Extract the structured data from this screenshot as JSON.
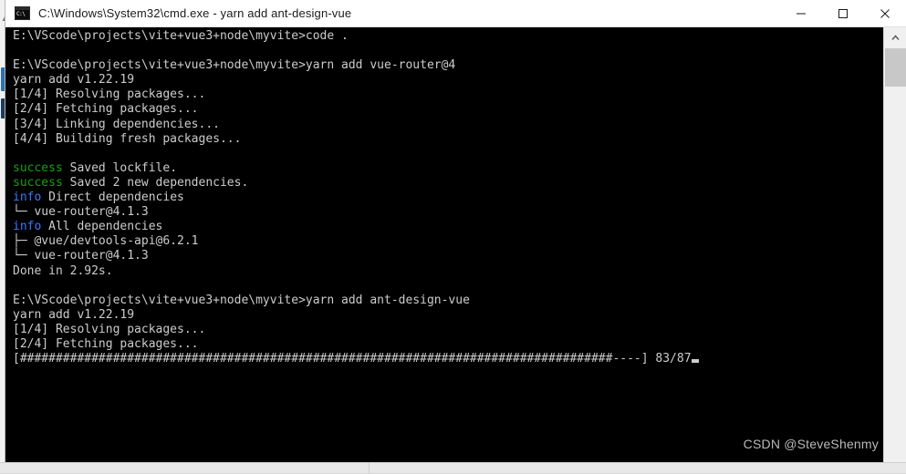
{
  "window": {
    "title": "C:\\Windows\\System32\\cmd.exe - yarn  add ant-design-vue",
    "icon": "cmd-console-icon",
    "icon_glyph": "C:\\",
    "controls": {
      "minimize": "minimize",
      "maximize": "maximize",
      "close": "close"
    }
  },
  "console": {
    "background": "#000000",
    "foreground": "#cccccc",
    "success_color": "#13a10e",
    "info_color": "#3b78ff",
    "lines": [
      {
        "text": "E:\\VScode\\projects\\vite+vue3+node\\myvite>code ."
      },
      {
        "text": ""
      },
      {
        "text": "E:\\VScode\\projects\\vite+vue3+node\\myvite>yarn add vue-router@4"
      },
      {
        "text": "yarn add v1.22.19"
      },
      {
        "text": "[1/4] Resolving packages..."
      },
      {
        "text": "[2/4] Fetching packages..."
      },
      {
        "text": "[3/4] Linking dependencies..."
      },
      {
        "text": "[4/4] Building fresh packages..."
      },
      {
        "text": ""
      },
      {
        "text": "success Saved lockfile.",
        "label": "success",
        "label_color": "green",
        "rest": " Saved lockfile."
      },
      {
        "text": "success Saved 2 new dependencies.",
        "label": "success",
        "label_color": "green",
        "rest": " Saved 2 new dependencies."
      },
      {
        "text": "info Direct dependencies",
        "label": "info",
        "label_color": "blue",
        "rest": " Direct dependencies"
      },
      {
        "text": "└─ vue-router@4.1.3"
      },
      {
        "text": "info All dependencies",
        "label": "info",
        "label_color": "blue",
        "rest": " All dependencies"
      },
      {
        "text": "├─ @vue/devtools-api@6.2.1"
      },
      {
        "text": "└─ vue-router@4.1.3"
      },
      {
        "text": "Done in 2.92s."
      },
      {
        "text": ""
      },
      {
        "text": "E:\\VScode\\projects\\vite+vue3+node\\myvite>yarn add ant-design-vue"
      },
      {
        "text": "yarn add v1.22.19"
      },
      {
        "text": "[1/4] Resolving packages..."
      },
      {
        "text": "[2/4] Fetching packages..."
      }
    ],
    "progress": {
      "open_bracket": "[",
      "filled_char": "#",
      "filled_count": 83,
      "empty_char": "-",
      "empty_count": 4,
      "close_bracket": "]",
      "counter": "83/87",
      "cursor": "block"
    }
  },
  "scrollbar": {
    "up_arrow": "chevron-up-icon",
    "thumb_label": "scroll-thumb"
  },
  "watermark": {
    "text": "CSDN @SteveShenmy"
  }
}
